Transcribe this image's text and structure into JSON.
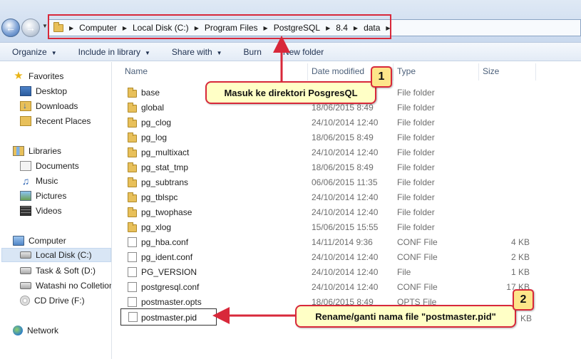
{
  "address": {
    "crumbs": [
      "Computer",
      "Local Disk (C:)",
      "Program Files",
      "PostgreSQL",
      "8.4",
      "data"
    ]
  },
  "toolbar": {
    "organize": "Organize",
    "include": "Include in library",
    "share": "Share with",
    "burn": "Burn",
    "new_folder": "New folder"
  },
  "sidebar": {
    "favorites": "Favorites",
    "desktop": "Desktop",
    "downloads": "Downloads",
    "recent": "Recent Places",
    "libraries": "Libraries",
    "documents": "Documents",
    "music": "Music",
    "pictures": "Pictures",
    "videos": "Videos",
    "computer": "Computer",
    "local_disk": "Local Disk (C:)",
    "task_soft": "Task & Soft (D:)",
    "watashi": "Watashi no Colletion",
    "cd_drive": "CD Drive (F:)",
    "network": "Network"
  },
  "columns": {
    "name": "Name",
    "date": "Date modified",
    "type": "Type",
    "size": "Size"
  },
  "files": [
    {
      "name": "base",
      "date": "",
      "type": "File folder",
      "size": "",
      "kind": "folder"
    },
    {
      "name": "global",
      "date": "18/06/2015 8:49",
      "type": "File folder",
      "size": "",
      "kind": "folder"
    },
    {
      "name": "pg_clog",
      "date": "24/10/2014 12:40",
      "type": "File folder",
      "size": "",
      "kind": "folder"
    },
    {
      "name": "pg_log",
      "date": "18/06/2015 8:49",
      "type": "File folder",
      "size": "",
      "kind": "folder"
    },
    {
      "name": "pg_multixact",
      "date": "24/10/2014 12:40",
      "type": "File folder",
      "size": "",
      "kind": "folder"
    },
    {
      "name": "pg_stat_tmp",
      "date": "18/06/2015 8:49",
      "type": "File folder",
      "size": "",
      "kind": "folder"
    },
    {
      "name": "pg_subtrans",
      "date": "06/06/2015 11:35",
      "type": "File folder",
      "size": "",
      "kind": "folder"
    },
    {
      "name": "pg_tblspc",
      "date": "24/10/2014 12:40",
      "type": "File folder",
      "size": "",
      "kind": "folder"
    },
    {
      "name": "pg_twophase",
      "date": "24/10/2014 12:40",
      "type": "File folder",
      "size": "",
      "kind": "folder"
    },
    {
      "name": "pg_xlog",
      "date": "15/06/2015 15:55",
      "type": "File folder",
      "size": "",
      "kind": "folder"
    },
    {
      "name": "pg_hba.conf",
      "date": "14/11/2014 9:36",
      "type": "CONF File",
      "size": "4 KB",
      "kind": "file"
    },
    {
      "name": "pg_ident.conf",
      "date": "24/10/2014 12:40",
      "type": "CONF File",
      "size": "2 KB",
      "kind": "file"
    },
    {
      "name": "PG_VERSION",
      "date": "24/10/2014 12:40",
      "type": "File",
      "size": "1 KB",
      "kind": "file"
    },
    {
      "name": "postgresql.conf",
      "date": "24/10/2014 12:40",
      "type": "CONF File",
      "size": "17 KB",
      "kind": "file"
    },
    {
      "name": "postmaster.opts",
      "date": "18/06/2015 8:49",
      "type": "OPTS File",
      "size": "",
      "kind": "file"
    }
  ],
  "rename": {
    "value": "postmaster.pid",
    "size_tail": "KB"
  },
  "callouts": {
    "c1_text": "Masuk ke direktori PosgresQL",
    "c1_num": "1",
    "c2_text": "Rename/ganti nama file \"postmaster.pid\"",
    "c2_num": "2"
  }
}
